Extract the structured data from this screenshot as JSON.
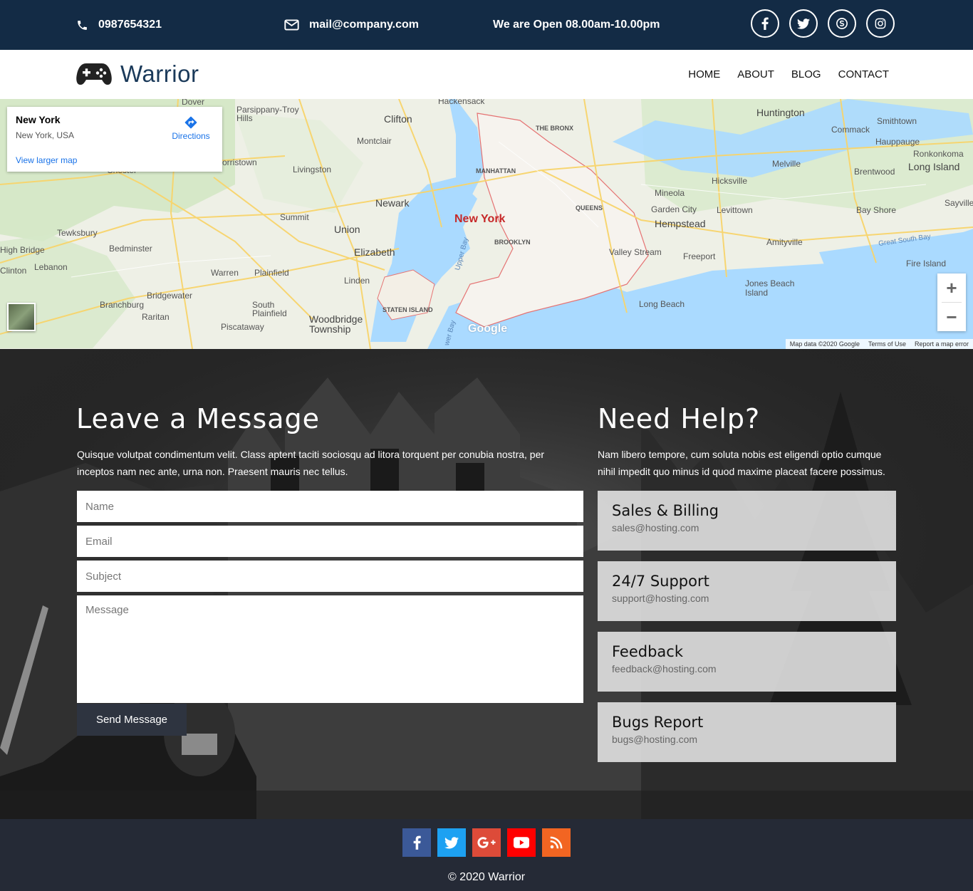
{
  "topbar": {
    "phone": "0987654321",
    "email": "mail@company.com",
    "hours": "We are Open 08.00am-10.00pm",
    "social_icons": [
      "facebook-icon",
      "twitter-icon",
      "skype-icon",
      "instagram-icon"
    ]
  },
  "nav": {
    "brand": "Warrior",
    "menu": [
      "HOME",
      "ABOUT",
      "BLOG",
      "CONTACT"
    ]
  },
  "map": {
    "card_title": "New York",
    "card_subtitle": "New York, USA",
    "directions_label": "Directions",
    "larger_map_label": "View larger map",
    "attribution": [
      "Map data ©2020 Google",
      "Terms of Use",
      "Report a map error"
    ],
    "google_label": "Google",
    "labels": {
      "new_york": "New York",
      "manhattan": "MANHATTAN",
      "brooklyn": "BROOKLYN",
      "queens": "QUEENS",
      "the_bronx": "THE BRONX",
      "staten_island": "STATEN ISLAND",
      "newark": "Newark",
      "clifton": "Clifton",
      "elizabeth": "Elizabeth",
      "union": "Union",
      "linden": "Linden",
      "summit": "Summit",
      "montclair": "Montclair",
      "livingston": "Livingston",
      "hackensack": "Hackensack",
      "huntington": "Huntington",
      "commack": "Commack",
      "smithtown": "Smithtown",
      "hauppauge": "Hauppauge",
      "ronkonkoma": "Ronkonkoma",
      "long_island": "Long Island",
      "brentwood": "Brentwood",
      "melville": "Melville",
      "hicksville": "Hicksville",
      "mineola": "Mineola",
      "garden_city": "Garden City",
      "levittown": "Levittown",
      "hempstead": "Hempstead",
      "bay_shore": "Bay Shore",
      "sayville": "Sayville",
      "amityville": "Amityville",
      "freeport": "Freeport",
      "valley_stream": "Valley Stream",
      "long_beach": "Long Beach",
      "jones_beach": "Jones Beach Island",
      "fire_island": "Fire Island",
      "great_south_bay": "Great South Bay",
      "parsippany": "Parsippany-Troy Hills",
      "morristown": "orristown",
      "dover": "Dover",
      "tewksbury": "Tewksbury",
      "bedminster": "Bedminster",
      "high_bridge": "High Bridge",
      "lebanon": "Lebanon",
      "clinton": "Clinton",
      "bridgewater": "Bridgewater",
      "branchburg": "Branchburg",
      "raritan": "Raritan",
      "south_plainfield": "South Plainfield",
      "plainfield": "Plainfield",
      "warren": "Warren",
      "piscataway": "Piscataway",
      "woodbridge": "Woodbridge Township",
      "chester": "Chester",
      "upper_bay": "Upper Bay",
      "lower_bay": "wer Bay"
    }
  },
  "contact": {
    "form_title": "Leave a Message",
    "form_text": "Quisque volutpat condimentum velit. Class aptent taciti sociosqu ad litora torquent per conubia nostra, per inceptos nam nec ante, urna non. Praesent mauris nec tellus.",
    "name_placeholder": "Name",
    "email_placeholder": "Email",
    "subject_placeholder": "Subject",
    "message_placeholder": "Message",
    "send_label": "Send Message",
    "help_title": "Need Help?",
    "help_text": "Nam libero tempore, cum soluta nobis est eligendi optio cumque nihil impedit quo minus id quod maxime placeat facere possimus.",
    "help_cards": [
      {
        "title": "Sales & Billing",
        "email": "sales@hosting.com"
      },
      {
        "title": "24/7 Support",
        "email": "support@hosting.com"
      },
      {
        "title": "Feedback",
        "email": "feedback@hosting.com"
      },
      {
        "title": "Bugs Report",
        "email": "bugs@hosting.com"
      }
    ]
  },
  "footer": {
    "social_icons": [
      "facebook-icon",
      "twitter-icon",
      "google-plus-icon",
      "youtube-icon",
      "rss-icon"
    ],
    "social_colors": [
      "#3b5998",
      "#1da1f2",
      "#dd4b39",
      "#ff0000",
      "#f26522"
    ],
    "copyright": "© 2020 Warrior"
  }
}
